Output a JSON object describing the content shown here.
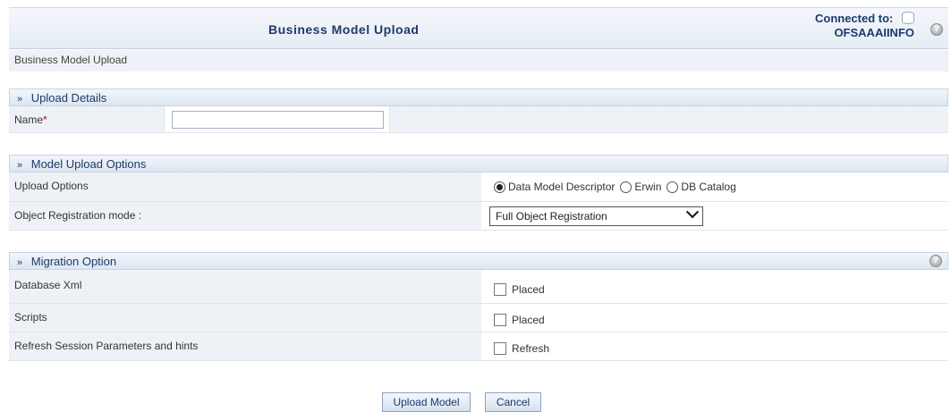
{
  "header": {
    "title": "Business Model Upload",
    "connected_label": "Connected to:",
    "connected_value": "OFSAAAIINFO",
    "help_glyph": "?"
  },
  "breadcrumb": "Business Model Upload",
  "upload_details": {
    "title": "Upload Details",
    "name_label": "Name",
    "required_mark": "*",
    "name_value": ""
  },
  "model_upload_options": {
    "title": "Model Upload Options",
    "upload_options_label": "Upload Options",
    "radio_options": [
      {
        "label": "Data Model Descriptor",
        "checked": true
      },
      {
        "label": "Erwin",
        "checked": false
      },
      {
        "label": "DB Catalog",
        "checked": false
      }
    ],
    "object_registration_label": "Object Registration mode :",
    "object_registration_value": "Full Object Registration"
  },
  "migration_option": {
    "title": "Migration Option",
    "rows": [
      {
        "label": "Database Xml",
        "checkbox_label": "Placed",
        "checked": false
      },
      {
        "label": "Scripts",
        "checkbox_label": "Placed",
        "checked": false
      },
      {
        "label": "Refresh Session Parameters and hints",
        "checkbox_label": "Refresh",
        "checked": false
      }
    ]
  },
  "buttons": {
    "upload": "Upload Model",
    "cancel": "Cancel"
  },
  "icons": {
    "section_chevron": "double-chevron-right-icon",
    "help": "help-icon",
    "database": "database-icon"
  },
  "colors": {
    "title_text": "#1d3a6b",
    "required": "#cc0000",
    "row_background": "#eef2f7"
  }
}
